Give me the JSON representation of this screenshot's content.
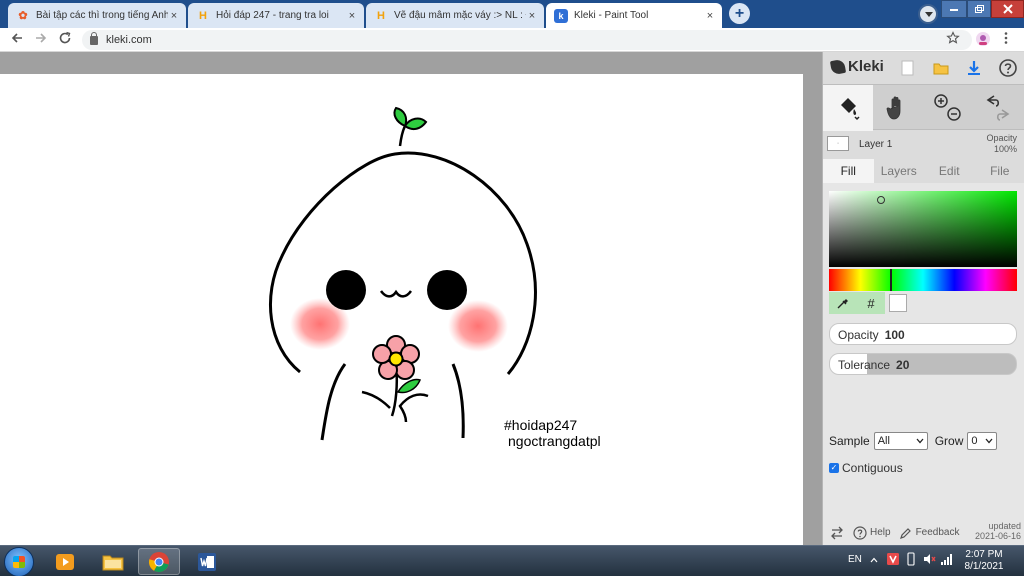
{
  "browser": {
    "tabs": [
      {
        "title": "Bài tập các thì trong tiếng Anh có",
        "favicon": "lotus-icon",
        "active": false
      },
      {
        "title": "Hỏi đáp 247 - trang tra loi",
        "favicon": "h-icon",
        "active": false
      },
      {
        "title": "Vẽ đậu mâm mặc váy :> NL : Đã",
        "favicon": "h-icon",
        "active": false
      },
      {
        "title": "Kleki - Paint Tool",
        "favicon": "kleki-icon",
        "active": true
      }
    ],
    "new_tab": "+",
    "close_glyph": "×",
    "url": "kleki.com"
  },
  "canvas": {
    "signature_lines": [
      "#hoidap247",
      "ngoctrangdatpl"
    ]
  },
  "kleki": {
    "logo_text": "Kleki",
    "layer": {
      "name": "Layer 1",
      "opacity_label": "Opacity",
      "opacity_value": "100%"
    },
    "tabs": [
      {
        "label": "Fill",
        "active": true
      },
      {
        "label": "Layers",
        "active": false
      },
      {
        "label": "Edit",
        "active": false
      },
      {
        "label": "File",
        "active": false
      }
    ],
    "fill": {
      "opacity_label": "Opacity",
      "opacity_value": "100",
      "tolerance_label": "Tolerance",
      "tolerance_value": "20",
      "tolerance_fraction": 0.2,
      "sample_label": "Sample",
      "sample_value": "All",
      "grow_label": "Grow",
      "grow_value": "0",
      "contiguous_label": "Contiguous",
      "contiguous_checked": true,
      "hex_symbol": "#"
    },
    "footer": {
      "help": "Help",
      "feedback": "Feedback",
      "updated_label": "updated",
      "updated_date": "2021-06-16"
    }
  },
  "taskbar": {
    "language": "EN",
    "time": "2:07 PM",
    "date": "8/1/2021"
  },
  "colors": {
    "chrome_frame": "#1f4e8c",
    "hue_selected": "#00e600",
    "blush": "#ff6b6b",
    "leaf": "#2ecc40",
    "flower_petal": "#f7a1a8",
    "flower_center": "#ffe600"
  }
}
